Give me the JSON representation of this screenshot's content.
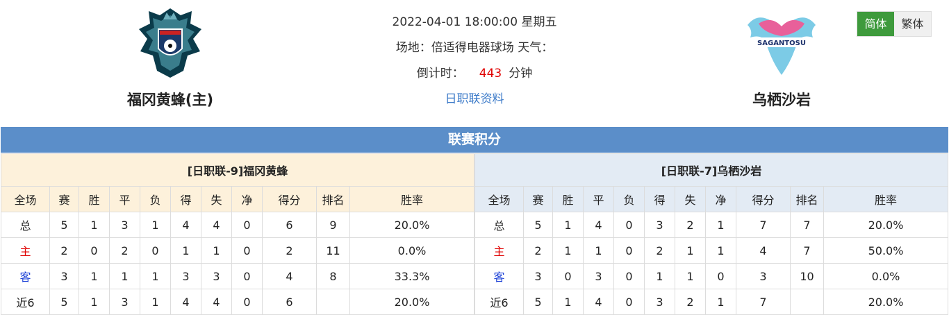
{
  "home_team": {
    "name": "福冈黄蜂(主)"
  },
  "away_team": {
    "name": "乌栖沙岩",
    "logo_text": "SAGANTOSU"
  },
  "match": {
    "datetime": "2022-04-01 18:00:00 星期五",
    "venue": "场地：倍适得电器球场 天气：",
    "countdown_label": "倒计时：",
    "countdown_value": "443",
    "countdown_unit": "分钟",
    "league_link": "日职联资料"
  },
  "lang": {
    "simplified": "简体",
    "traditional": "繁体"
  },
  "section_title": "联赛积分",
  "columns": [
    "全场",
    "赛",
    "胜",
    "平",
    "负",
    "得",
    "失",
    "净",
    "得分",
    "排名",
    "胜率"
  ],
  "left_table": {
    "caption": "[日职联-9]福冈黄蜂",
    "rows": [
      [
        "总",
        "5",
        "1",
        "3",
        "1",
        "4",
        "4",
        "0",
        "6",
        "9",
        "20.0%"
      ],
      [
        "主",
        "2",
        "0",
        "2",
        "0",
        "1",
        "1",
        "0",
        "2",
        "11",
        "0.0%"
      ],
      [
        "客",
        "3",
        "1",
        "1",
        "1",
        "3",
        "3",
        "0",
        "4",
        "8",
        "33.3%"
      ],
      [
        "近6",
        "5",
        "1",
        "3",
        "1",
        "4",
        "4",
        "0",
        "6",
        "",
        "20.0%"
      ]
    ]
  },
  "right_table": {
    "caption": "[日职联-7]乌栖沙岩",
    "rows": [
      [
        "总",
        "5",
        "1",
        "4",
        "0",
        "3",
        "2",
        "1",
        "7",
        "7",
        "20.0%"
      ],
      [
        "主",
        "2",
        "1",
        "1",
        "0",
        "2",
        "1",
        "1",
        "4",
        "7",
        "50.0%"
      ],
      [
        "客",
        "3",
        "0",
        "3",
        "0",
        "1",
        "1",
        "0",
        "3",
        "10",
        "0.0%"
      ],
      [
        "近6",
        "5",
        "1",
        "4",
        "0",
        "3",
        "2",
        "1",
        "7",
        "",
        "20.0%"
      ]
    ]
  }
}
